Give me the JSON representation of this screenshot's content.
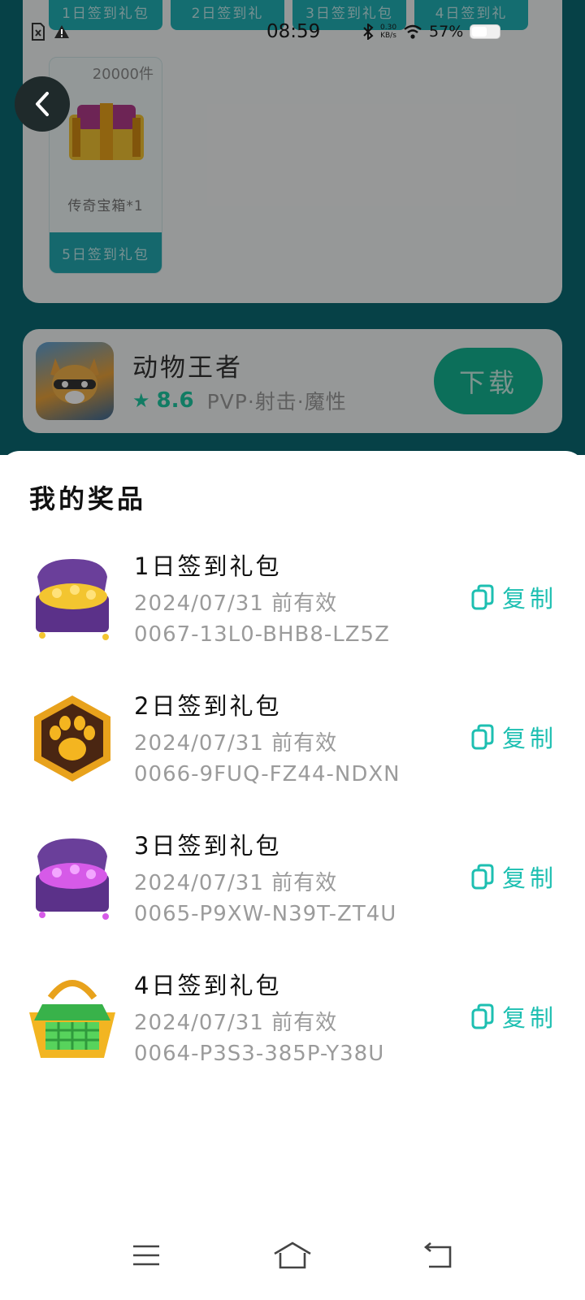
{
  "background": {
    "daily_cards": [
      {
        "label": "1日签到礼包"
      },
      {
        "label": "2日签到礼"
      },
      {
        "label": "3日签到礼包"
      },
      {
        "label": "4日签到礼"
      }
    ],
    "day5": {
      "quantity": "20000件",
      "item": "传奇宝箱*1",
      "label": "5日签到礼包"
    },
    "game": {
      "name": "动物王者",
      "rating": "8.6",
      "tags": "PVP·射击·魔性",
      "download_label": "下载"
    }
  },
  "statusbar": {
    "time": "08:59",
    "speed_top": "0.30",
    "speed_bottom": "KB/s",
    "battery": "57%"
  },
  "sheet": {
    "title": "我的奖品",
    "copy_label": "复制",
    "prizes": [
      {
        "name": "1日签到礼包",
        "expire": "2024/07/31 前有效",
        "code": "0067-13L0-BHB8-LZ5Z",
        "icon": "gold-treasure-chest-icon"
      },
      {
        "name": "2日签到礼包",
        "expire": "2024/07/31 前有效",
        "code": "0066-9FUQ-FZ44-NDXN",
        "icon": "paw-badge-icon"
      },
      {
        "name": "3日签到礼包",
        "expire": "2024/07/31 前有效",
        "code": "0065-P9XW-N39T-ZT4U",
        "icon": "gem-treasure-chest-icon"
      },
      {
        "name": "4日签到礼包",
        "expire": "2024/07/31 前有效",
        "code": "0064-P3S3-385P-Y38U",
        "icon": "green-basket-icon"
      }
    ]
  },
  "colors": {
    "accent": "#1dbfb1",
    "download": "#14b492",
    "background_teal": "#0b6a73"
  }
}
